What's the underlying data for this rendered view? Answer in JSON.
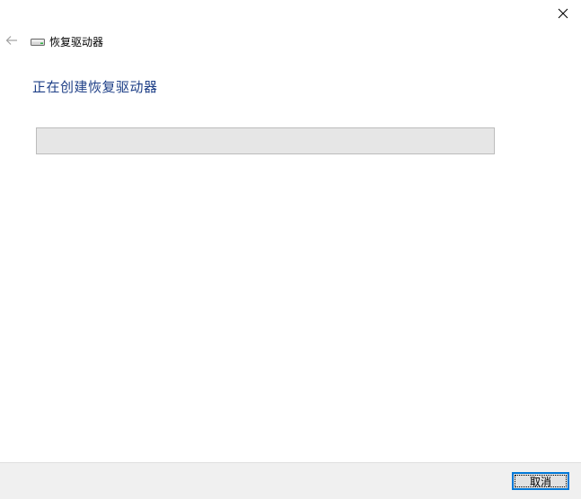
{
  "window": {
    "title": "恢复驱动器",
    "close_icon": "close-icon",
    "back_icon": "back-arrow-icon",
    "drive_icon": "drive-icon"
  },
  "main": {
    "heading": "正在创建恢复驱动器",
    "progress": 0
  },
  "footer": {
    "cancel_label": "取消"
  },
  "colors": {
    "heading": "#1e3f87",
    "accent": "#0078d7",
    "progress_track": "#e6e6e6"
  }
}
